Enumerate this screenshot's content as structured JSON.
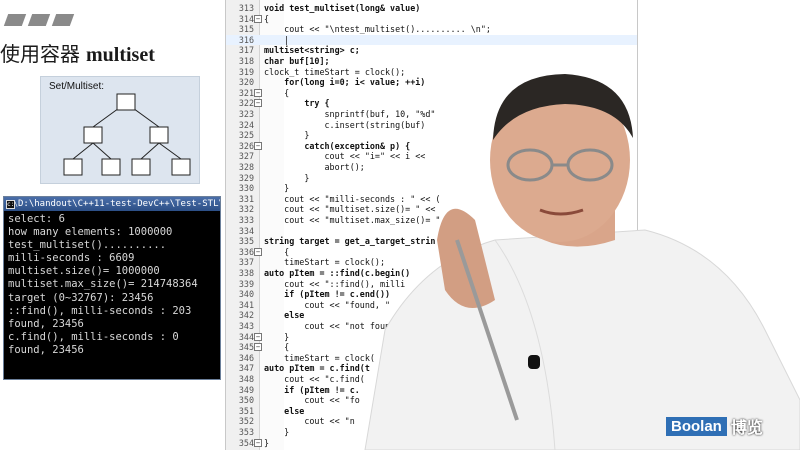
{
  "slide": {
    "title_cn": "使用容器",
    "title_en": "multiset"
  },
  "diagram": {
    "label": "Set/Multiset:"
  },
  "console": {
    "title": "D:\\handout\\C++11-test-DevC++\\Test-STL\\te",
    "lines": [
      "select: 6",
      "how many elements: 1000000",
      "",
      "test_multiset()..........",
      "milli-seconds : 6609",
      "multiset.size()= 1000000",
      "multiset.max_size()= 214748364",
      "target (0~32767): 23456",
      "::find(), milli-seconds : 203",
      "found, 23456",
      "c.find(), milli-seconds : 0",
      "found, 23456"
    ]
  },
  "editor": {
    "lines": [
      {
        "n": "313",
        "t": "void test_multiset(long& value)"
      },
      {
        "n": "314",
        "t": "{"
      },
      {
        "n": "315",
        "t": "    cout << \"\\ntest_multiset().......... \\n\";"
      },
      {
        "n": "316",
        "t": "    |"
      },
      {
        "n": "317",
        "t": "multiset<string> c;"
      },
      {
        "n": "318",
        "t": "char buf[10];"
      },
      {
        "n": "319",
        "t": "clock_t timeStart = clock();"
      },
      {
        "n": "320",
        "t": "    for(long i=0; i< value; ++i)"
      },
      {
        "n": "321",
        "t": "    {"
      },
      {
        "n": "322",
        "t": "        try {"
      },
      {
        "n": "323",
        "t": "            snprintf(buf, 10, \"%d\""
      },
      {
        "n": "324",
        "t": "            c.insert(string(buf)"
      },
      {
        "n": "325",
        "t": "        }"
      },
      {
        "n": "326",
        "t": "        catch(exception& p) {"
      },
      {
        "n": "327",
        "t": "            cout << \"i=\" << i <<"
      },
      {
        "n": "328",
        "t": "            abort();"
      },
      {
        "n": "329",
        "t": "        }"
      },
      {
        "n": "330",
        "t": "    }"
      },
      {
        "n": "331",
        "t": "    cout << \"milli-seconds : \" << ("
      },
      {
        "n": "332",
        "t": "    cout << \"multiset.size()= \" <<"
      },
      {
        "n": "333",
        "t": "    cout << \"multiset.max_size()= \""
      },
      {
        "n": "334",
        "t": ""
      },
      {
        "n": "335",
        "t": "string target = get_a_target_strin"
      },
      {
        "n": "336",
        "t": "    {"
      },
      {
        "n": "337",
        "t": "    timeStart = clock();"
      },
      {
        "n": "338",
        "t": "auto pItem = ::find(c.begin()"
      },
      {
        "n": "339",
        "t": "    cout << \"::find(), milli"
      },
      {
        "n": "340",
        "t": "    if (pItem != c.end())"
      },
      {
        "n": "341",
        "t": "        cout << \"found, \""
      },
      {
        "n": "342",
        "t": "    else"
      },
      {
        "n": "343",
        "t": "        cout << \"not foun"
      },
      {
        "n": "344",
        "t": "    }"
      },
      {
        "n": "345",
        "t": "    {"
      },
      {
        "n": "346",
        "t": "    timeStart = clock("
      },
      {
        "n": "347",
        "t": "auto pItem = c.find(t"
      },
      {
        "n": "348",
        "t": "    cout << \"c.find("
      },
      {
        "n": "349",
        "t": "    if (pItem != c."
      },
      {
        "n": "350",
        "t": "        cout << \"fo"
      },
      {
        "n": "351",
        "t": "    else"
      },
      {
        "n": "352",
        "t": "        cout << \"n"
      },
      {
        "n": "353",
        "t": "    }"
      },
      {
        "n": "354",
        "t": "}"
      }
    ],
    "highlight_line": 3,
    "fold_rows": [
      1,
      8,
      9,
      13,
      23,
      31,
      32,
      41
    ]
  },
  "logo": {
    "brand": "Boolan",
    "cn": "博览"
  },
  "colors": {
    "accent": "#2f6fb5",
    "keyword": "#000080",
    "string": "#0000c8",
    "highlight": "#e8f2ff",
    "console_bg": "#000000",
    "diagram_bg": "#dde5ef"
  }
}
